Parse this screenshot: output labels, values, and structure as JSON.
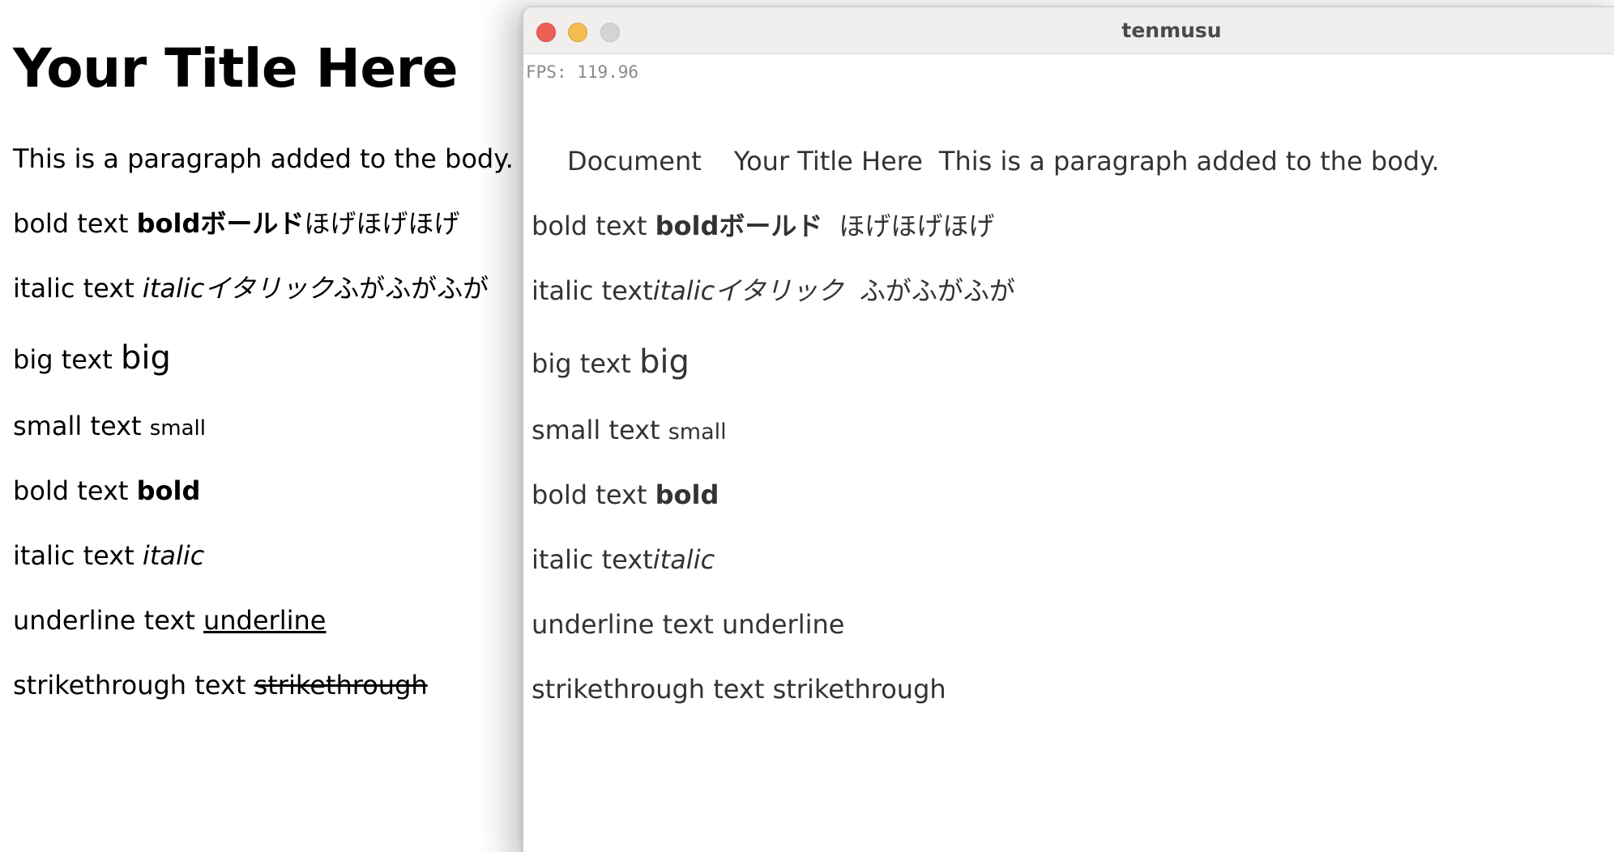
{
  "reference": {
    "title": "Your Title Here",
    "paragraph": "This is a paragraph added to the body.",
    "bold_jp": {
      "prefix": "bold text ",
      "strong": "boldボールド",
      "suffix": "ほげほげほげ"
    },
    "italic_jp": {
      "prefix": "italic text ",
      "em": "italicイタリック",
      "suffix": "ふがふがふが"
    },
    "big": {
      "prefix": "big text ",
      "big": "big"
    },
    "small": {
      "prefix": "small text ",
      "small": "small"
    },
    "bold": {
      "prefix": "bold text ",
      "strong": "bold"
    },
    "italic": {
      "prefix": "italic text ",
      "em": "italic"
    },
    "underline": {
      "prefix": "underline text ",
      "u": "underline"
    },
    "strike": {
      "prefix": "strikethrough text ",
      "s": "strikethrough"
    }
  },
  "window": {
    "title": "tenmusu",
    "fps": "FPS: 119.96",
    "colors": {
      "close": "#ec5f56",
      "minimize": "#f4bd4f",
      "maximize": "#d4d4d4"
    },
    "content": {
      "doc_title": "Document",
      "heading": "Your Title Here",
      "paragraph": "This is a paragraph added to the body.",
      "bold_jp": {
        "prefix": "bold text ",
        "strong": "boldボールド",
        "suffix": "ほげほげほげ"
      },
      "italic_jp": {
        "prefix": "italic text",
        "em": "italicイタリック",
        "suffix": "ふがふがふが"
      },
      "big": {
        "prefix": "big text ",
        "big": "big"
      },
      "small": {
        "prefix": "small text ",
        "small": "small"
      },
      "bold": {
        "prefix": "bold text ",
        "strong": "bold"
      },
      "italic": {
        "prefix": "italic text",
        "em": "italic"
      },
      "underline": {
        "prefix": "underline text ",
        "u": "underline"
      },
      "strike": {
        "prefix": "strikethrough text ",
        "s": "strikethrough"
      }
    }
  }
}
